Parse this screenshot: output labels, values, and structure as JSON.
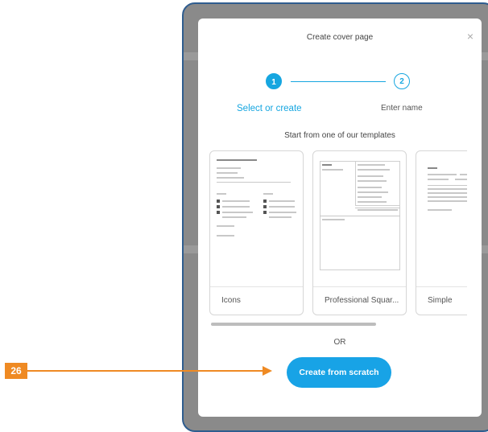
{
  "dialog": {
    "title": "Create cover page",
    "close_glyph": "×"
  },
  "stepper": {
    "steps": [
      {
        "number": "1",
        "label": "Select or create",
        "state": "active"
      },
      {
        "number": "2",
        "label": "Enter name",
        "state": "inactive"
      }
    ]
  },
  "templates": {
    "heading": "Start from one of our templates",
    "cards": [
      {
        "label": "Icons"
      },
      {
        "label": "Professional Squar..."
      },
      {
        "label": "Simple"
      }
    ]
  },
  "or_text": "OR",
  "cta": {
    "label": "Create from scratch"
  },
  "callout": {
    "number": "26"
  },
  "colors": {
    "accent": "#16a6e0",
    "callout": "#ef8a23",
    "frame_border": "#2f5d8f"
  }
}
